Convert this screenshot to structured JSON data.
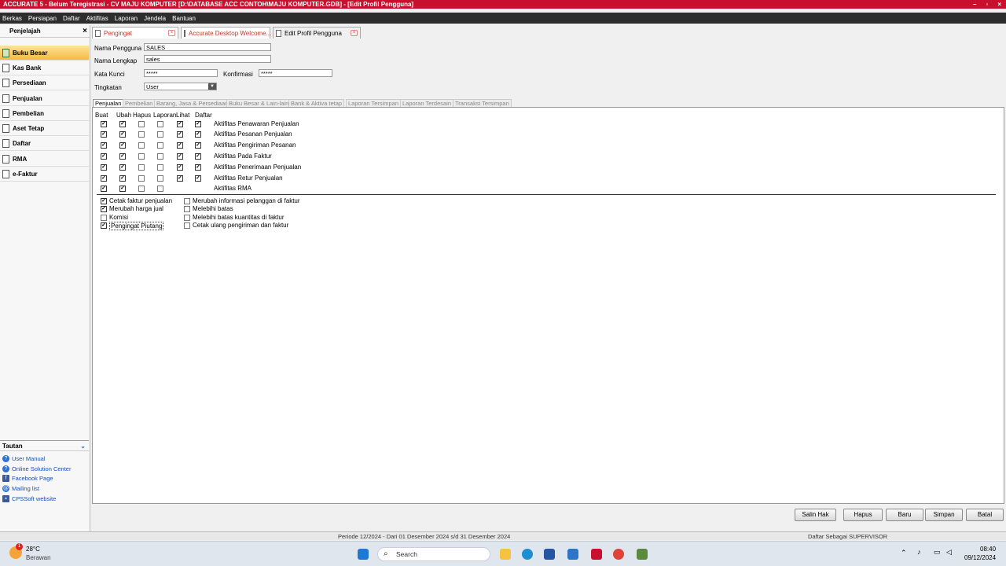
{
  "window": {
    "title": "ACCURATE 5 - Belum Teregistrasi - CV MAJU KOMPUTER   [D:\\DATABASE ACC CONTOH\\MAJU KOMPUTER.GDB] - [Edit Profil Pengguna]",
    "controls": [
      "–",
      "▫",
      "×"
    ]
  },
  "menu": [
    "Berkas",
    "Persiapan",
    "Daftar",
    "Aktifitas",
    "Laporan",
    "Jendela",
    "Bantuan"
  ],
  "sidebar": {
    "title": "Penjelajah",
    "close": "×",
    "items": [
      {
        "label": "Buku Besar",
        "active": true
      },
      {
        "label": "Kas Bank"
      },
      {
        "label": "Persediaan"
      },
      {
        "label": "Penjualan"
      },
      {
        "label": "Pembelian"
      },
      {
        "label": "Aset Tetap"
      },
      {
        "label": "Daftar"
      },
      {
        "label": "RMA"
      },
      {
        "label": "e-Faktur"
      }
    ],
    "tautan_title": "Tautan",
    "links": [
      "User Manual",
      "Online Solution Center",
      "Facebook Page",
      "Mailing list",
      "CPSSoft website"
    ]
  },
  "tabs": [
    "Pengingat",
    "Accurate Desktop Welcome...",
    "Edit Profil Pengguna"
  ],
  "form": {
    "nama_pengguna_label": "Nama Pengguna",
    "nama_pengguna_value": "SALES",
    "nama_lengkap_label": "Nama Lengkap",
    "nama_lengkap_value": "sales",
    "kata_kunci_label": "Kata Kunci",
    "kata_kunci_value": "*****",
    "konfirmasi_label": "Konfirmasi",
    "konfirmasi_value": "*****",
    "tingkatan_label": "Tingkatan",
    "tingkatan_value": "User"
  },
  "subtabs": [
    "Penjualan",
    "Pembelian",
    "Barang, Jasa & Persediaan",
    "Buku Besar & Lain-lain",
    "Bank & Aktiva tetap",
    "Laporan Tersimpan",
    "Laporan Terdesain",
    "Transaksi Tersimpan"
  ],
  "columns": [
    "Buat",
    "Ubah",
    "Hapus",
    "Laporan",
    "Lihat",
    "Daftar"
  ],
  "rows": [
    {
      "label": "Aktifitas Penawaran Penjualan",
      "checks": [
        true,
        true,
        false,
        false,
        true,
        true
      ]
    },
    {
      "label": "Aktifitas Pesanan Penjualan",
      "checks": [
        true,
        true,
        false,
        false,
        true,
        true
      ]
    },
    {
      "label": "Aktifitas Pengiriman Pesanan",
      "checks": [
        true,
        true,
        false,
        false,
        true,
        true
      ]
    },
    {
      "label": "Aktifitas Pada Faktur",
      "checks": [
        true,
        true,
        false,
        false,
        true,
        true
      ]
    },
    {
      "label": "Aktifitas Penerimaan Penjualan",
      "checks": [
        true,
        true,
        false,
        false,
        true,
        true
      ]
    },
    {
      "label": "Aktifitas Retur Penjualan",
      "checks": [
        true,
        true,
        false,
        false,
        true,
        true
      ]
    },
    {
      "label": "Aktifitas RMA",
      "checks": [
        true,
        true,
        false,
        false,
        null,
        null
      ]
    }
  ],
  "options_left": [
    {
      "label": "Cetak faktur penjualan",
      "checked": true
    },
    {
      "label": "Merubah harga jual",
      "checked": true
    },
    {
      "label": "Komisi",
      "checked": false
    },
    {
      "label": "Pengingat Piutang",
      "checked": true
    }
  ],
  "options_right": [
    {
      "label": "Merubah informasi pelanggan di faktur",
      "checked": false
    },
    {
      "label": "Melebihi batas",
      "checked": false
    },
    {
      "label": "Melebihi batas kuantitas di faktur",
      "checked": false
    },
    {
      "label": "Cetak ulang pengiriman dan faktur",
      "checked": false
    }
  ],
  "buttons": [
    "Salin Hak",
    "Hapus",
    "Baru",
    "Simpan",
    "Batal"
  ],
  "status": {
    "periode": "Periode 12/2024 - Dari 01 Desember 2024 s/d 31 Desember 2024",
    "login": "Daftar Sebagai SUPERVISOR"
  },
  "taskbar": {
    "weather_temp": "28°C",
    "weather_desc": "Berawan",
    "weather_badge": "1",
    "search_placeholder": "Search",
    "time": "08:40",
    "date": "09/12/2024"
  },
  "colors": {
    "titlebar": "#c8102e",
    "menubar": "#2d2d2d",
    "active_nav": "#f5b942",
    "link": "#1a4fb0"
  }
}
